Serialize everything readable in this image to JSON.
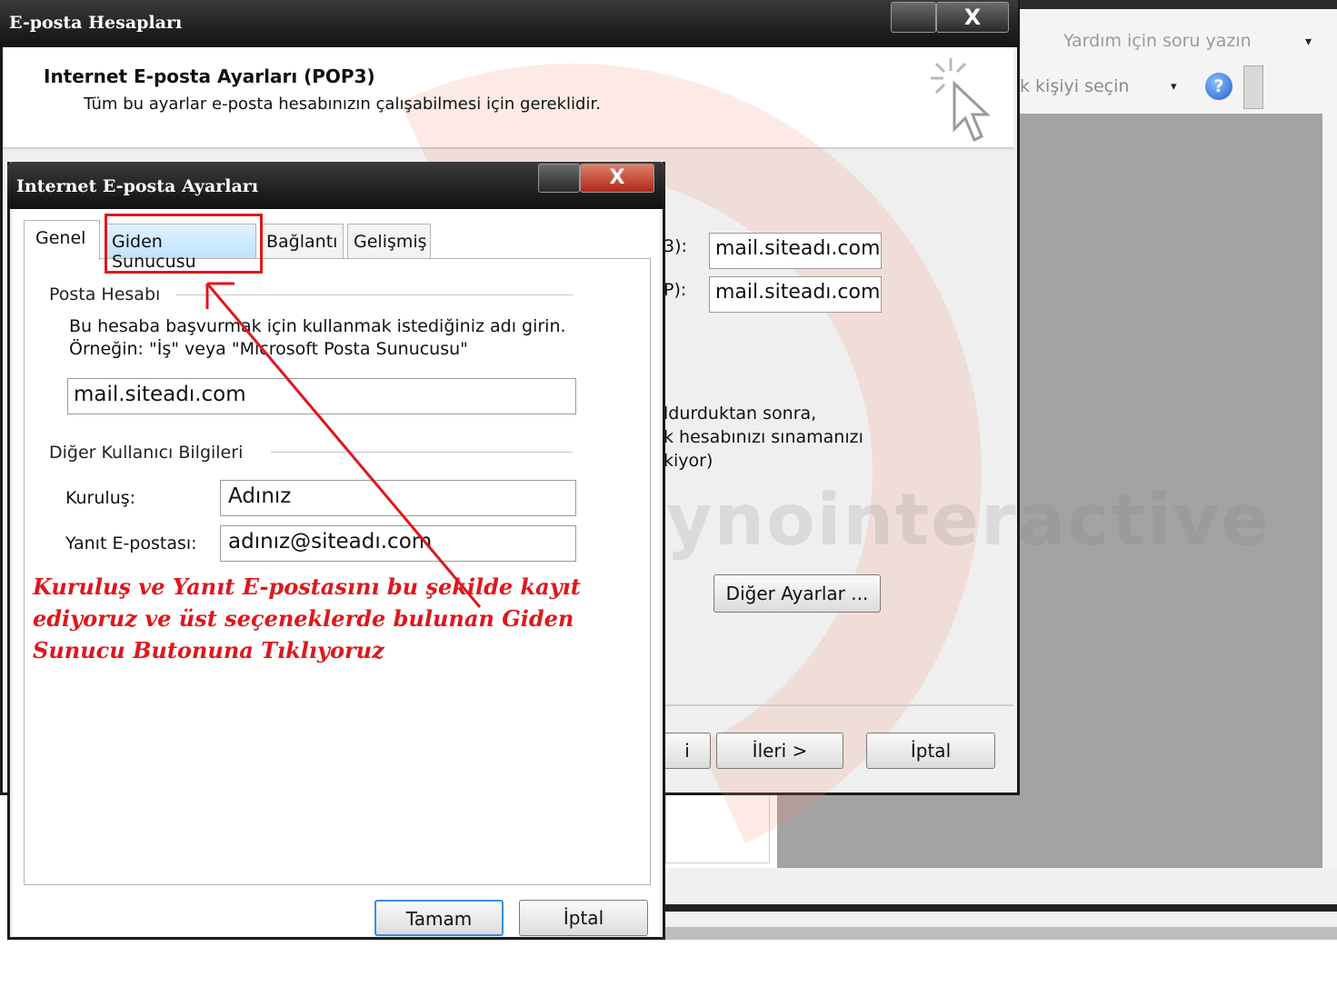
{
  "outlook": {
    "help_placeholder": "Yardım için soru yazın",
    "person_placeholder": "k kişiyi seçin",
    "help_icon_glyph": "?"
  },
  "accounts_dialog": {
    "title": "E-posta Hesapları",
    "heading": "Internet E-posta Ayarları (POP3)",
    "subheading": "Tüm bu ayarlar e-posta hesabınızın çalışabilmesi için gereklidir.",
    "pop3_label_tail": "3):",
    "smtp_label_tail": "P):",
    "incoming_server": "mail.siteadı.com",
    "outgoing_server": "mail.siteadı.com",
    "test_text": [
      "ldurduktan sonra,",
      "k hesabınızı sınamanızı",
      "kiyor)"
    ],
    "more_settings": "Diğer Ayarlar ...",
    "back_label": "i",
    "next_label": "İleri >",
    "cancel_label": "İptal",
    "close_glyph": "X",
    "watermark": "raynointeractive"
  },
  "settings_dialog": {
    "title": "Internet E-posta Ayarları",
    "close_glyph": "X",
    "tabs": [
      {
        "label": "Genel"
      },
      {
        "label": "Giden Sunucusu"
      },
      {
        "label": "Bağlantı"
      },
      {
        "label": "Gelişmiş"
      }
    ],
    "mail_account_group": "Posta Hesabı",
    "help_line1": "Bu hesaba başvurmak için kullanmak istediğiniz adı girin.",
    "help_line2": "Örneğin: \"İş\" veya \"Microsoft Posta Sunucusu\"",
    "account_name": "mail.siteadı.com",
    "other_info_group": "Diğer Kullanıcı Bilgileri",
    "org_label": "Kuruluş:",
    "org_value": "Adınız",
    "reply_label": "Yanıt E-postası:",
    "reply_value": "adınız@siteadı.com",
    "ok_label": "Tamam",
    "cancel_label": "İptal"
  },
  "annotation": {
    "text": "Kuruluş ve Yanıt E-postasını bu şekilde kayıt ediyoruz ve üst seçeneklerde bulunan Giden Sunucu Butonuna Tıklıyoruz",
    "color": "#e0161b"
  }
}
